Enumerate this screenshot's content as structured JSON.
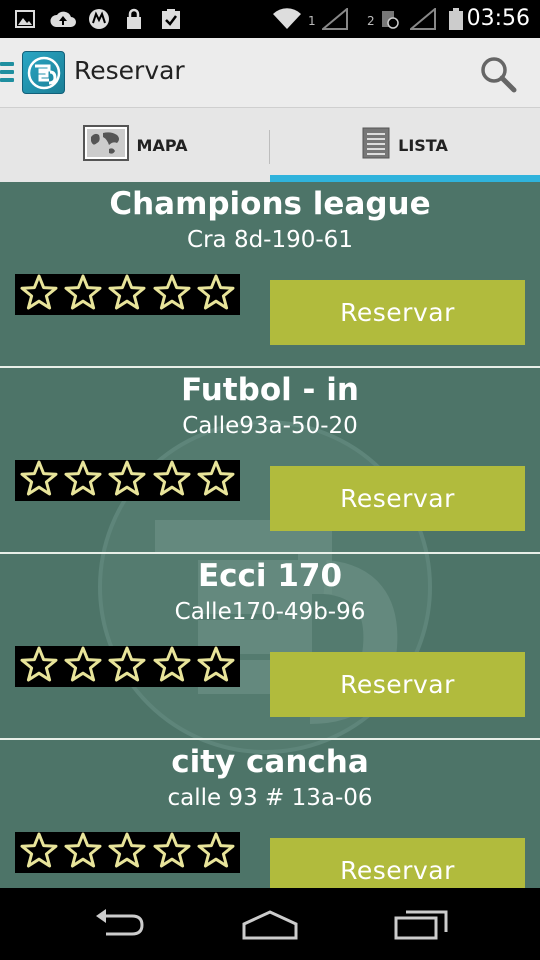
{
  "status_bar": {
    "time": "03:56",
    "sim1": "1",
    "sim2": "2",
    "icons": [
      "image-icon",
      "upload-cloud-icon",
      "motorola-icon",
      "lock-icon",
      "clipboard-check-icon",
      "wifi-icon",
      "signal-icon",
      "signal-icon",
      "battery-icon"
    ]
  },
  "action_bar": {
    "title": "Reservar",
    "icons": [
      "drawer-icon",
      "app-logo-icon",
      "search-icon"
    ]
  },
  "tabs": [
    {
      "label": "MAPA",
      "icon": "map-icon",
      "selected": false
    },
    {
      "label": "LISTA",
      "icon": "list-icon",
      "selected": true
    }
  ],
  "colors": {
    "list_background": "#4d7468",
    "reserve_button": "#b1bb3d",
    "tab_indicator": "#2fb3dc",
    "star_outline": "#e8e49a"
  },
  "venues": [
    {
      "name": "Champions league",
      "address": "Cra 8d-190-61",
      "stars_filled": 0,
      "stars_total": 5,
      "button": "Reservar"
    },
    {
      "name": "Futbol - in",
      "address": "Calle93a-50-20",
      "stars_filled": 0,
      "stars_total": 5,
      "button": "Reservar"
    },
    {
      "name": "Ecci 170",
      "address": "Calle170-49b-96",
      "stars_filled": 0,
      "stars_total": 5,
      "button": "Reservar"
    },
    {
      "name": "city cancha",
      "address": "calle 93 # 13a-06",
      "stars_filled": 0,
      "stars_total": 5,
      "button": "Reservar"
    }
  ],
  "nav_bar": {
    "icons": [
      "back-icon",
      "home-icon",
      "recent-apps-icon"
    ]
  }
}
